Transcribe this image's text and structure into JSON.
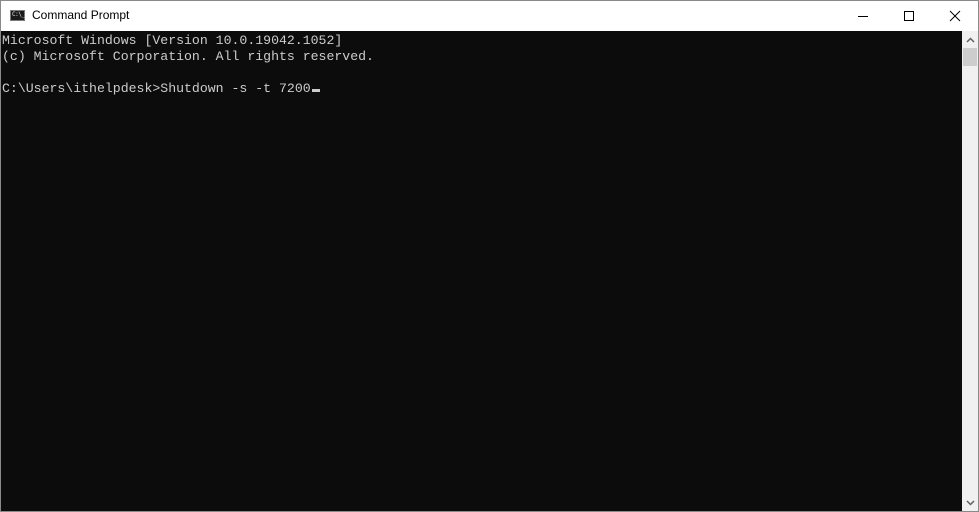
{
  "window": {
    "title": "Command Prompt",
    "icon": "cmd-icon",
    "icon_text": "C:\\_",
    "controls": {
      "minimize": "minimize-icon",
      "maximize": "maximize-icon",
      "close": "close-icon"
    }
  },
  "console": {
    "lines": [
      "Microsoft Windows [Version 10.0.19042.1052]",
      "(c) Microsoft Corporation. All rights reserved.",
      "",
      "C:\\Users\\ithelpdesk>Shutdown -s -t 7200"
    ],
    "prompt": "C:\\Users\\ithelpdesk>",
    "command": "Shutdown -s -t 7200",
    "colors": {
      "background": "#0c0c0c",
      "foreground": "#cccccc"
    }
  },
  "scrollbar": {
    "up": "chevron-up-icon",
    "down": "chevron-down-icon"
  }
}
